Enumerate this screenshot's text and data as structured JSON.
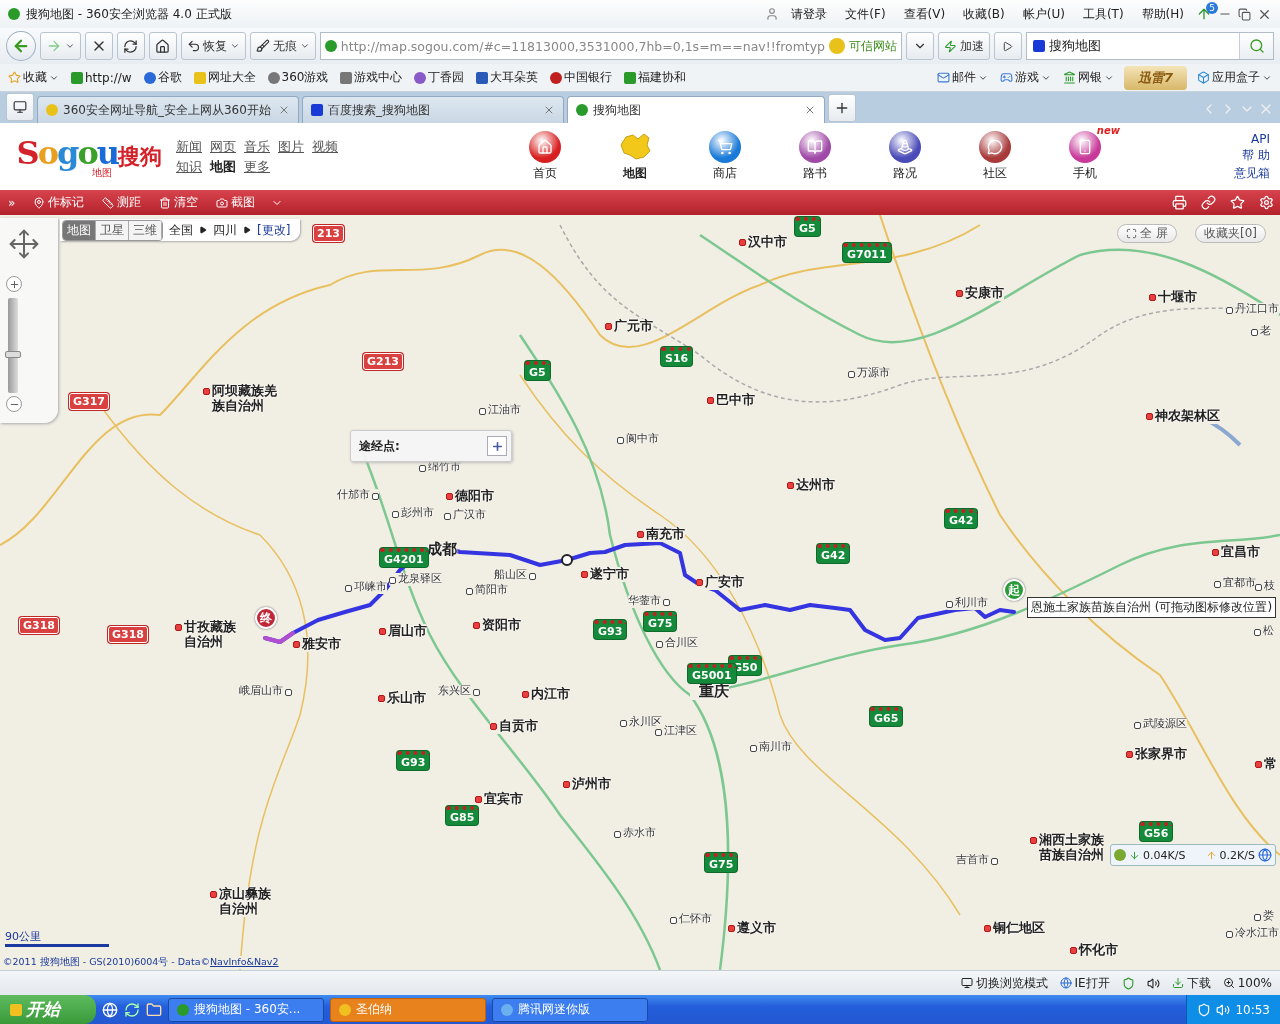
{
  "window": {
    "title": "搜狗地图 - 360安全浏览器 4.0 正式版",
    "user": "请登录",
    "menus": [
      "文件(F)",
      "查看(V)",
      "收藏(B)",
      "帐户(U)",
      "工具(T)",
      "帮助(H)"
    ],
    "update_badge": "5"
  },
  "toolbar": {
    "restore": "恢复",
    "incognito": "无痕",
    "address": "http://map.sogou.com/#c=11813000,3531000,7hb=0,1s=m==nav!!fromtyp",
    "trusted": "可信网站",
    "speedup": "加速",
    "search_value": "搜狗地图"
  },
  "bookmarks": {
    "left": [
      "收藏",
      "http://w",
      "谷歌",
      "网址大全",
      "360游戏",
      "游戏中心",
      "丁香园",
      "大耳朵英",
      "中国银行",
      "福建协和"
    ],
    "right": [
      "邮件",
      "游戏",
      "网银"
    ],
    "overlay_badge": "迅雷7",
    "apps": "应用盒子"
  },
  "tabs": [
    {
      "label": "360安全网址导航_安全上网从360开始",
      "selected": false
    },
    {
      "label": "百度搜索_搜狗地图",
      "selected": false
    },
    {
      "label": "搜狗地图",
      "selected": true
    }
  ],
  "site": {
    "logo": "Sogou",
    "logo_cn": "搜狗",
    "logo_sub": "地图",
    "links": [
      [
        {
          "label": "新闻",
          "selected": false
        },
        {
          "label": "网页",
          "selected": false
        },
        {
          "label": "音乐",
          "selected": false
        },
        {
          "label": "图片",
          "selected": false
        },
        {
          "label": "视频",
          "selected": false
        }
      ],
      [
        {
          "label": "知识",
          "selected": false
        },
        {
          "label": "地图",
          "selected": true
        },
        {
          "label": "更多",
          "selected": false
        }
      ]
    ],
    "nav": [
      {
        "label": "首页",
        "kind": "home",
        "selected": false
      },
      {
        "label": "地图",
        "kind": "map",
        "selected": true
      },
      {
        "label": "商店",
        "kind": "shop",
        "selected": false
      },
      {
        "label": "路书",
        "kind": "book",
        "selected": false
      },
      {
        "label": "路况",
        "kind": "traffic",
        "selected": false
      },
      {
        "label": "社区",
        "kind": "community",
        "selected": false
      },
      {
        "label": "手机",
        "kind": "phone",
        "selected": false,
        "badge": "new"
      }
    ],
    "right_links": [
      "API",
      "帮 助",
      "意见箱"
    ]
  },
  "map_toolbar": {
    "expand": "»",
    "tools": [
      {
        "label": "作标记",
        "kind": "marker"
      },
      {
        "label": "测距",
        "kind": "ruler"
      },
      {
        "label": "清空",
        "kind": "clear"
      },
      {
        "label": "截图",
        "kind": "capture"
      }
    ]
  },
  "map": {
    "types": [
      {
        "label": "地图",
        "selected": true
      },
      {
        "label": "卫星",
        "selected": false
      },
      {
        "label": "三维",
        "selected": false
      }
    ],
    "breadcrumb": [
      "全国",
      "四川"
    ],
    "change": "[更改]",
    "zoom": {
      "level": 0.4
    },
    "fullscreen": "全 屏",
    "favorites": "收藏夹[0]",
    "waypoint": "途经点:",
    "places": [
      {
        "name": "汉中市",
        "kind": "city"
      },
      {
        "name": "安康市",
        "kind": "city"
      },
      {
        "name": "十堰市",
        "kind": "city"
      },
      {
        "name": "丹江口市",
        "kind": "county"
      },
      {
        "name": "老",
        "kind": "county"
      },
      {
        "name": "广元市",
        "kind": "city"
      },
      {
        "name": "阿坝藏族羌族自治州",
        "kind": "city"
      },
      {
        "name": "万源市",
        "kind": "county"
      },
      {
        "name": "巴中市",
        "kind": "city"
      },
      {
        "name": "江油市",
        "kind": "county"
      },
      {
        "name": "神农架林区",
        "kind": "city"
      },
      {
        "name": "阆中市",
        "kind": "county"
      },
      {
        "name": "绵竹市",
        "kind": "county"
      },
      {
        "name": "什邡市",
        "kind": "county"
      },
      {
        "name": "德阳市",
        "kind": "city"
      },
      {
        "name": "达州市",
        "kind": "city"
      },
      {
        "name": "彭州市",
        "kind": "county"
      },
      {
        "name": "广汉市",
        "kind": "county"
      },
      {
        "name": "成都",
        "kind": "major"
      },
      {
        "name": "龙泉驿区",
        "kind": "county"
      },
      {
        "name": "南充市",
        "kind": "city"
      },
      {
        "name": "宜昌市",
        "kind": "city"
      },
      {
        "name": "宜都市",
        "kind": "county"
      },
      {
        "name": "枝",
        "kind": "county"
      },
      {
        "name": "船山区",
        "kind": "county"
      },
      {
        "name": "遂宁市",
        "kind": "city"
      },
      {
        "name": "邛崃市",
        "kind": "county"
      },
      {
        "name": "简阳市",
        "kind": "county"
      },
      {
        "name": "广安市",
        "kind": "city"
      },
      {
        "name": "华蓥市",
        "kind": "county"
      },
      {
        "name": "利川市",
        "kind": "county"
      },
      {
        "name": "甘孜藏族自治州",
        "kind": "city"
      },
      {
        "name": "雅安市",
        "kind": "city"
      },
      {
        "name": "眉山市",
        "kind": "city"
      },
      {
        "name": "资阳市",
        "kind": "city"
      },
      {
        "name": "合川区",
        "kind": "county"
      },
      {
        "name": "松",
        "kind": "county"
      },
      {
        "name": "峨眉山市",
        "kind": "county"
      },
      {
        "name": "乐山市",
        "kind": "city"
      },
      {
        "name": "东兴区",
        "kind": "county"
      },
      {
        "name": "内江市",
        "kind": "city"
      },
      {
        "name": "重庆",
        "kind": "major"
      },
      {
        "name": "自贡市",
        "kind": "city"
      },
      {
        "name": "永川区",
        "kind": "county"
      },
      {
        "name": "江津区",
        "kind": "county"
      },
      {
        "name": "南川市",
        "kind": "county"
      },
      {
        "name": "武陵源区",
        "kind": "county"
      },
      {
        "name": "张家界市",
        "kind": "city"
      },
      {
        "name": "常",
        "kind": "city"
      },
      {
        "name": "宜宾市",
        "kind": "city"
      },
      {
        "name": "泸州市",
        "kind": "city"
      },
      {
        "name": "赤水市",
        "kind": "county"
      },
      {
        "name": "吉首市",
        "kind": "county"
      },
      {
        "name": "湘西土家族苗族自治州",
        "kind": "city"
      },
      {
        "name": "凉山彝族自治州",
        "kind": "city"
      },
      {
        "name": "仁怀市",
        "kind": "county"
      },
      {
        "name": "遵义市",
        "kind": "city"
      },
      {
        "name": "铜仁地区",
        "kind": "city"
      },
      {
        "name": "怀化市",
        "kind": "city"
      },
      {
        "name": "娄",
        "kind": "county"
      },
      {
        "name": "冷水江市",
        "kind": "county"
      }
    ],
    "shields": [
      {
        "label": "G5",
        "kind": "expressway"
      },
      {
        "label": "G7011",
        "kind": "expressway"
      },
      {
        "label": "S16",
        "kind": "expressway"
      },
      {
        "label": "G5",
        "kind": "expressway"
      },
      {
        "label": "G42",
        "kind": "expressway"
      },
      {
        "label": "G42",
        "kind": "expressway"
      },
      {
        "label": "G4201",
        "kind": "expressway"
      },
      {
        "label": "G75",
        "kind": "expressway"
      },
      {
        "label": "G93",
        "kind": "expressway"
      },
      {
        "label": "G50",
        "kind": "expressway"
      },
      {
        "label": "G5001",
        "kind": "expressway"
      },
      {
        "label": "G65",
        "kind": "expressway"
      },
      {
        "label": "G93",
        "kind": "expressway"
      },
      {
        "label": "G85",
        "kind": "expressway"
      },
      {
        "label": "G75",
        "kind": "expressway"
      },
      {
        "label": "G56",
        "kind": "expressway"
      },
      {
        "label": "213",
        "kind": "national"
      },
      {
        "label": "G213",
        "kind": "national"
      },
      {
        "label": "G317",
        "kind": "national"
      },
      {
        "label": "G318",
        "kind": "national"
      },
      {
        "label": "G318",
        "kind": "national"
      }
    ],
    "start_marker": "起",
    "end_marker": "终",
    "start_tooltip": "恩施土家族苗族自治州 (可拖动图标修改位置)",
    "scale": "90公里",
    "copyright": "©2011 搜狗地图 - GS(2010)6004号 - Data©",
    "data_link": "NavInfo&Nav2",
    "speed": {
      "down": "0.04K/S",
      "up": "0.2K/S"
    }
  },
  "status_bar": {
    "items": [
      "切换浏览模式",
      "IE打开",
      "下载",
      "100%"
    ]
  },
  "taskbar": {
    "start": "开始",
    "tasks": [
      {
        "label": "搜狗地图 - 360安...",
        "selected": false
      },
      {
        "label": "圣伯纳",
        "selected": true
      },
      {
        "label": "腾讯网迷你版",
        "selected": false
      }
    ],
    "clock": "10:53"
  }
}
